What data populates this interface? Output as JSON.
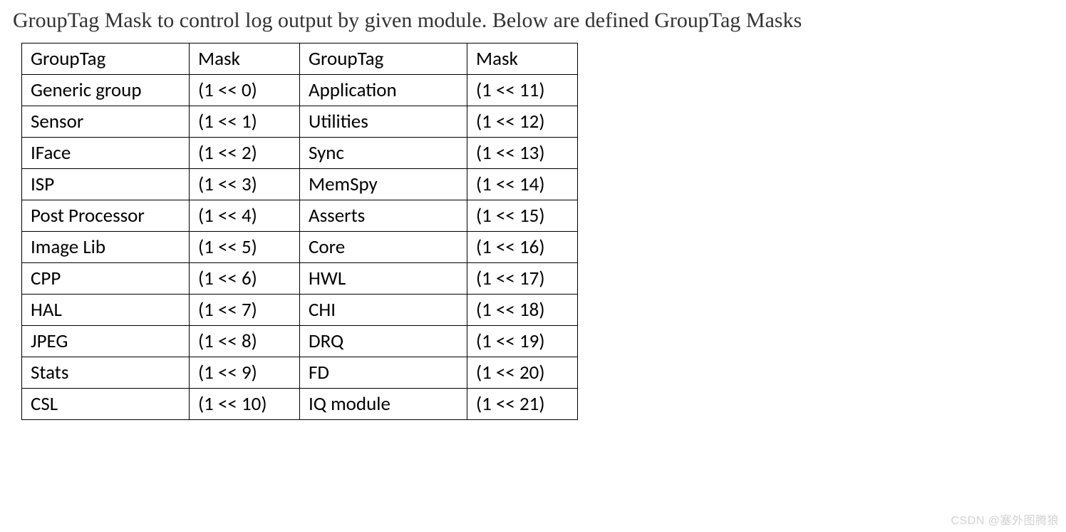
{
  "intro": "GroupTag Mask to control log output by given module. Below are defined GroupTag Masks",
  "table": {
    "headers": {
      "c0": "GroupTag",
      "c1": "Mask",
      "c2": "GroupTag",
      "c3": "Mask"
    },
    "rows": [
      {
        "c0": "Generic group",
        "c1": "(1 << 0)",
        "c2": "Application",
        "c3": "(1 << 11)"
      },
      {
        "c0": "Sensor",
        "c1": "(1 << 1)",
        "c2": "Utilities",
        "c3": "(1 << 12)"
      },
      {
        "c0": "IFace",
        "c1": "(1 << 2)",
        "c2": "Sync",
        "c3": "(1 << 13)"
      },
      {
        "c0": "ISP",
        "c1": "(1 << 3)",
        "c2": "MemSpy",
        "c3": "(1 << 14)"
      },
      {
        "c0": "Post Processor",
        "c1": "(1 << 4)",
        "c2": "Asserts",
        "c3": "(1 << 15)"
      },
      {
        "c0": "Image Lib",
        "c1": "(1 << 5)",
        "c2": "Core",
        "c3": "(1 << 16)"
      },
      {
        "c0": "CPP",
        "c1": "(1 << 6)",
        "c2": "HWL",
        "c3": "(1 << 17)"
      },
      {
        "c0": "HAL",
        "c1": "(1 << 7)",
        "c2": "CHI",
        "c3": "(1 << 18)"
      },
      {
        "c0": "JPEG",
        "c1": "(1 << 8)",
        "c2": "DRQ",
        "c3": "(1 << 19)"
      },
      {
        "c0": "Stats",
        "c1": "(1 << 9)",
        "c2": "FD",
        "c3": "(1 << 20)"
      },
      {
        "c0": "CSL",
        "c1": "(1 << 10)",
        "c2": "IQ module",
        "c3": "(1 << 21)"
      }
    ]
  },
  "watermark": "CSDN @塞外图腾狼"
}
